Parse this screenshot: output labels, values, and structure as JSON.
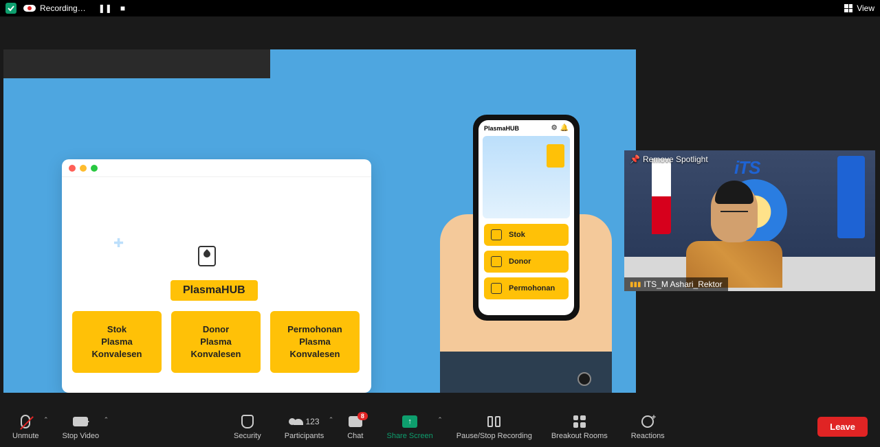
{
  "topbar": {
    "recording": "Recording…",
    "view": "View"
  },
  "share": {
    "hub_title": "PlasmaHUB",
    "cards": [
      {
        "l1": "Stok",
        "l2": "Plasma",
        "l3": "Konvalesen"
      },
      {
        "l1": "Donor",
        "l2": "Plasma",
        "l3": "Konvalesen"
      },
      {
        "l1": "Permohonan",
        "l2": "Plasma",
        "l3": "Konvalesen"
      }
    ],
    "phone": {
      "app": "PlasmaHUB",
      "buttons": [
        "Stok",
        "Donor",
        "Permohonan"
      ]
    }
  },
  "pip": {
    "remove": "Remove Spotlight",
    "logo": "iTS",
    "name": "ITS_M Ashari_Rektor"
  },
  "toolbar": {
    "unmute": "Unmute",
    "stop_video": "Stop Video",
    "security": "Security",
    "participants": "Participants",
    "participants_count": "123",
    "chat": "Chat",
    "chat_badge": "8",
    "share": "Share Screen",
    "pause_rec": "Pause/Stop Recording",
    "breakout": "Breakout Rooms",
    "reactions": "Reactions",
    "leave": "Leave"
  }
}
